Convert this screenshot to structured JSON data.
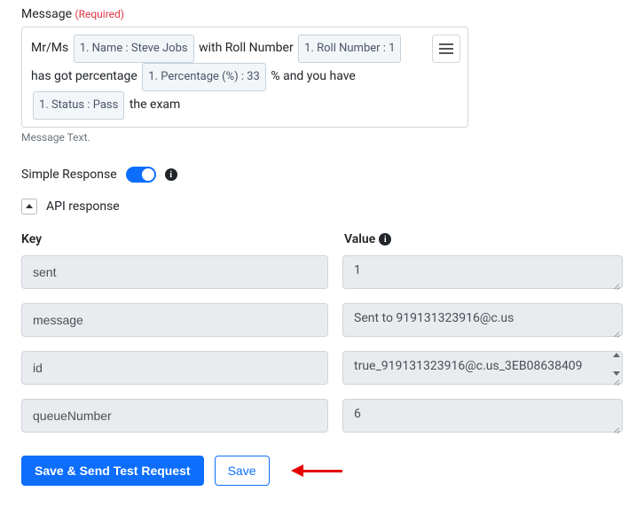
{
  "message": {
    "label": "Message",
    "required_label": "(Required)",
    "helper": "Message Text.",
    "parts": {
      "t1": "Mr/Ms",
      "token_name": "1. Name : Steve Jobs",
      "t2": "with Roll Number",
      "token_roll": "1. Roll Number : 1",
      "t3": "has got percentage",
      "token_pct": "1. Percentage (%) : 33",
      "t4": "% and you have",
      "token_status": "1. Status : Pass",
      "t5": "the exam"
    }
  },
  "simple_response": {
    "label": "Simple Response",
    "on": true
  },
  "api_response": {
    "label": "API response",
    "headers": {
      "key": "Key",
      "value": "Value"
    },
    "rows": [
      {
        "key": "sent",
        "value": "1"
      },
      {
        "key": "message",
        "value": "Sent to 919131323916@c.us"
      },
      {
        "key": "id",
        "value": "true_919131323916@c.us_3EB08638409"
      },
      {
        "key": "queueNumber",
        "value": "6"
      }
    ]
  },
  "buttons": {
    "save_send": "Save & Send Test Request",
    "save": "Save"
  }
}
